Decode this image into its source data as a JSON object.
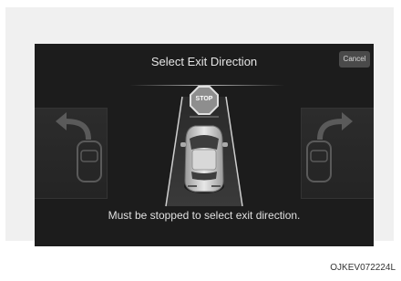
{
  "screen": {
    "title": "Select Exit Direction",
    "cancel_label": "Cancel",
    "stop_sign_text": "STOP",
    "message": "Must be stopped to select exit direction."
  },
  "left_option": {
    "direction": "left",
    "icon": "arrow-up-left-icon"
  },
  "right_option": {
    "direction": "right",
    "icon": "arrow-up-right-icon"
  },
  "figure_code": "OJKEV072224L",
  "colors": {
    "screen_bg": "#1c1c1c",
    "stop_red": "#8e8e8e",
    "text": "#e6e6e6"
  }
}
